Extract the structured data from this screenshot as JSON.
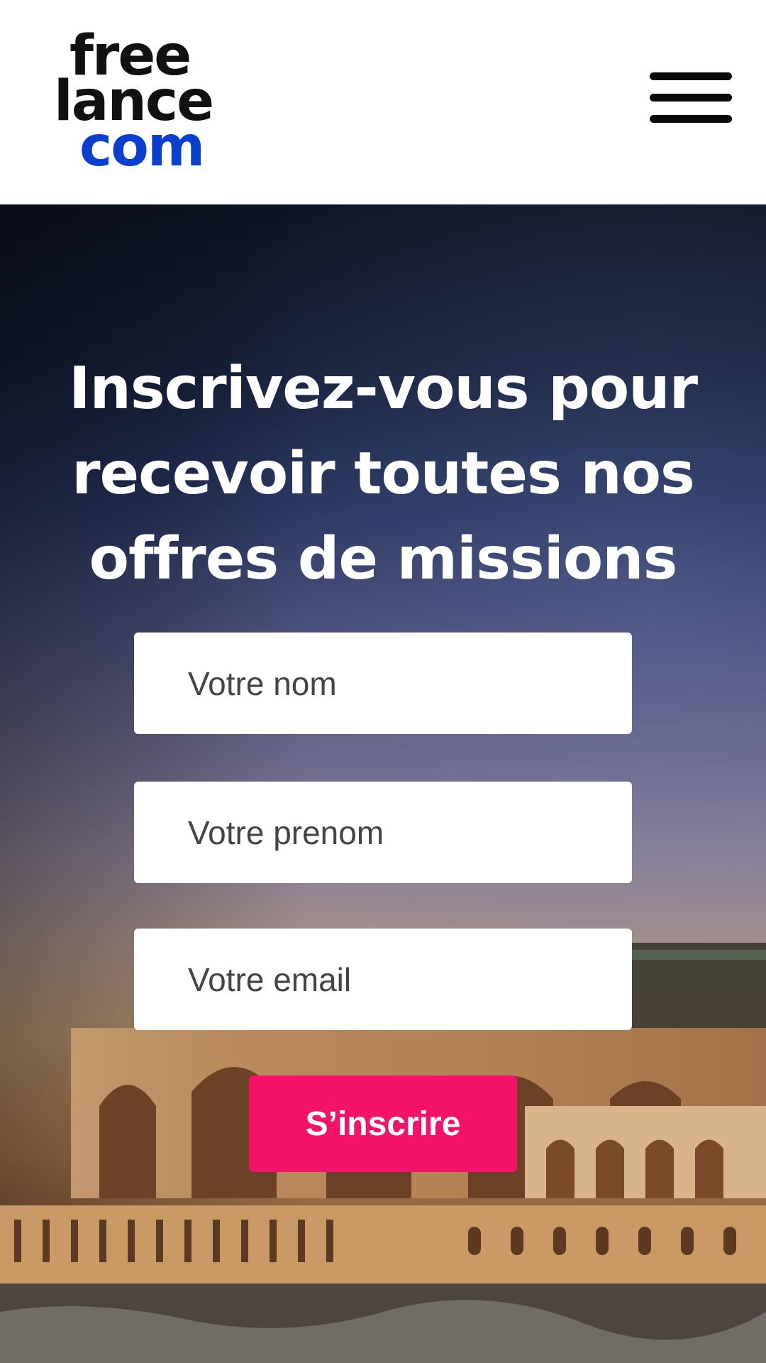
{
  "header": {
    "logo_line1": "free",
    "logo_line2": "lance",
    "logo_line3": "com",
    "menu_icon": "hamburger-menu-icon"
  },
  "hero": {
    "title": "Inscrivez-vous pour recevoir toutes nos offres de missions",
    "background": "mosque-seafront-sunset-photo"
  },
  "form": {
    "name_placeholder": "Votre nom",
    "firstname_placeholder": "Votre prenom",
    "email_placeholder": "Votre email",
    "submit_label": "S’inscrire"
  },
  "colors": {
    "accent": "#f4126a",
    "brand_blue": "#0a3fd0",
    "progress": "#2a8fd8"
  }
}
